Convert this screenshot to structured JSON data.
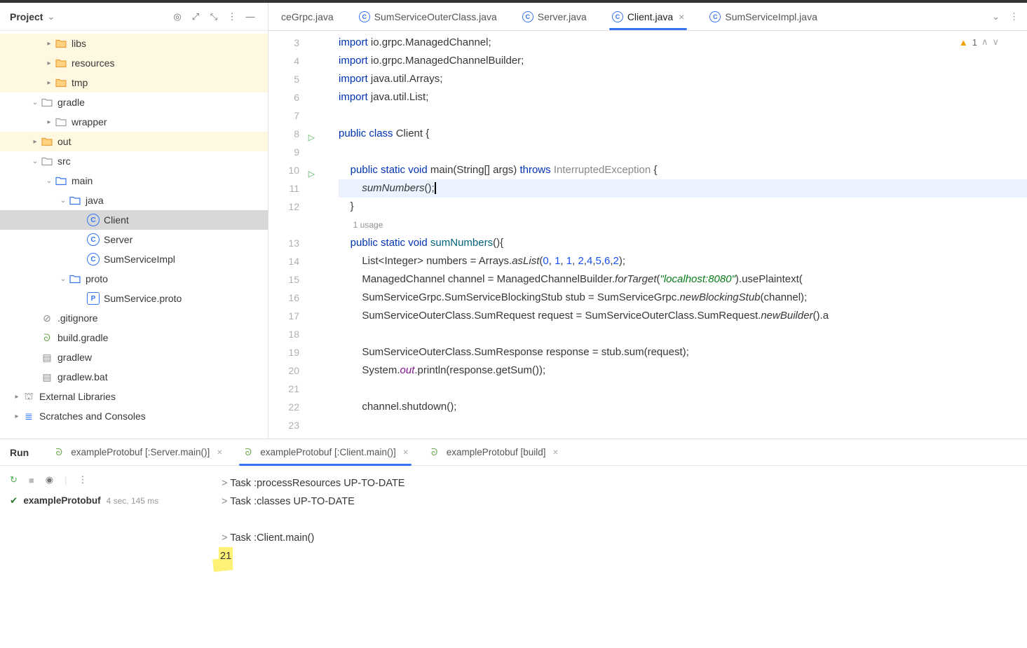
{
  "sidebar": {
    "title": "Project",
    "nodes": [
      {
        "indent": 62,
        "arrow": "▸",
        "type": "folder-hl",
        "label": "libs"
      },
      {
        "indent": 62,
        "arrow": "▸",
        "type": "folder-hl",
        "label": "resources"
      },
      {
        "indent": 62,
        "arrow": "▸",
        "type": "folder-hl",
        "label": "tmp"
      },
      {
        "indent": 42,
        "arrow": "⌄",
        "type": "folder",
        "label": "gradle"
      },
      {
        "indent": 62,
        "arrow": "▸",
        "type": "folder",
        "label": "wrapper"
      },
      {
        "indent": 42,
        "arrow": "▸",
        "type": "folder-hl",
        "label": "out",
        "hl": true
      },
      {
        "indent": 42,
        "arrow": "⌄",
        "type": "folder",
        "label": "src"
      },
      {
        "indent": 62,
        "arrow": "⌄",
        "type": "folder-blue",
        "label": "main"
      },
      {
        "indent": 82,
        "arrow": "⌄",
        "type": "folder-blue",
        "label": "java"
      },
      {
        "indent": 108,
        "arrow": "",
        "type": "java",
        "label": "Client",
        "sel": true
      },
      {
        "indent": 108,
        "arrow": "",
        "type": "java",
        "label": "Server"
      },
      {
        "indent": 108,
        "arrow": "",
        "type": "java",
        "label": "SumServiceImpl"
      },
      {
        "indent": 82,
        "arrow": "⌄",
        "type": "folder-blue",
        "label": "proto"
      },
      {
        "indent": 108,
        "arrow": "",
        "type": "proto",
        "label": "SumService.proto"
      },
      {
        "indent": 42,
        "arrow": "",
        "type": "ignore",
        "label": ".gitignore"
      },
      {
        "indent": 42,
        "arrow": "",
        "type": "gradle",
        "label": "build.gradle"
      },
      {
        "indent": 42,
        "arrow": "",
        "type": "term",
        "label": "gradlew"
      },
      {
        "indent": 42,
        "arrow": "",
        "type": "term",
        "label": "gradlew.bat"
      },
      {
        "indent": 16,
        "arrow": "▸",
        "type": "lib",
        "label": "External Libraries"
      },
      {
        "indent": 16,
        "arrow": "▸",
        "type": "scratch",
        "label": "Scratches and Consoles"
      }
    ]
  },
  "tabs": [
    {
      "label": "ceGrpc.java",
      "partial": true
    },
    {
      "label": "SumServiceOuterClass.java"
    },
    {
      "label": "Server.java"
    },
    {
      "label": "Client.java",
      "active": true,
      "closable": true
    },
    {
      "label": "SumServiceImpl.java"
    }
  ],
  "inspection": {
    "warn_count": "1"
  },
  "gutter_start": 3,
  "gutter_runs": {
    "8": true,
    "10": true
  },
  "code": {
    "l3a": "import",
    "l3b": " io.grpc.ManagedChannel;",
    "l4a": "import",
    "l4b": " io.grpc.ManagedChannelBuilder;",
    "l5a": "import",
    "l5b": " java.util.Arrays;",
    "l6a": "import",
    "l6b": " java.util.List;",
    "l8": "public class ",
    "l8b": "Client {",
    "l10a": "    public static void ",
    "l10b": "main",
    "l10c": "(String[] args) ",
    "l10d": "throws ",
    "l10e": "InterruptedException {",
    "l11": "         sumNumbers();",
    "l12": "    }",
    "usage": "1 usage",
    "l13a": "    public static void ",
    "l13b": "sumNumbers",
    "l13c": "(){",
    "l14a": "        List<Integer> numbers = Arrays.",
    "l14b": "asList",
    "l14c": "(",
    "n0": "0",
    "c": ", ",
    "n1": "1",
    "n2": "1",
    "n3": "2",
    "n4": "4",
    "n5": "5",
    "n6": "6",
    "n7": "2",
    "l14d": ");",
    "l15a": "        ManagedChannel channel = ManagedChannelBuilder.",
    "l15b": "forTarget",
    "l15c": "(",
    "l15s": "\"localhost:8080\"",
    "l15d": ").usePlaintext(",
    "l16": "        SumServiceGrpc.SumServiceBlockingStub stub = SumServiceGrpc.",
    "l16b": "newBlockingStub",
    "l16c": "(channel);",
    "l17": "        SumServiceOuterClass.SumRequest request = SumServiceOuterClass.SumRequest.",
    "l17b": "newBuilder",
    "l17c": "().a",
    "l19": "        SumServiceOuterClass.SumResponse response = stub.sum(request);",
    "l20a": "        System.",
    "l20b": "out",
    "l20c": ".println(response.getSum());",
    "l22": "        channel.shutdown();",
    "l24": "    }"
  },
  "run": {
    "title": "Run",
    "tabs": [
      {
        "label": "exampleProtobuf [:Server.main()]",
        "closable": true
      },
      {
        "label": "exampleProtobuf [:Client.main()]",
        "closable": true,
        "active": true
      },
      {
        "label": "exampleProtobuf [build]",
        "closable": true
      }
    ],
    "entry_name": "exampleProtobuf",
    "entry_time": "4 sec, 145 ms",
    "console": [
      "> Task :processResources UP-TO-DATE",
      "> Task :classes UP-TO-DATE",
      "",
      "> Task :Client.main()"
    ],
    "result": "21"
  }
}
